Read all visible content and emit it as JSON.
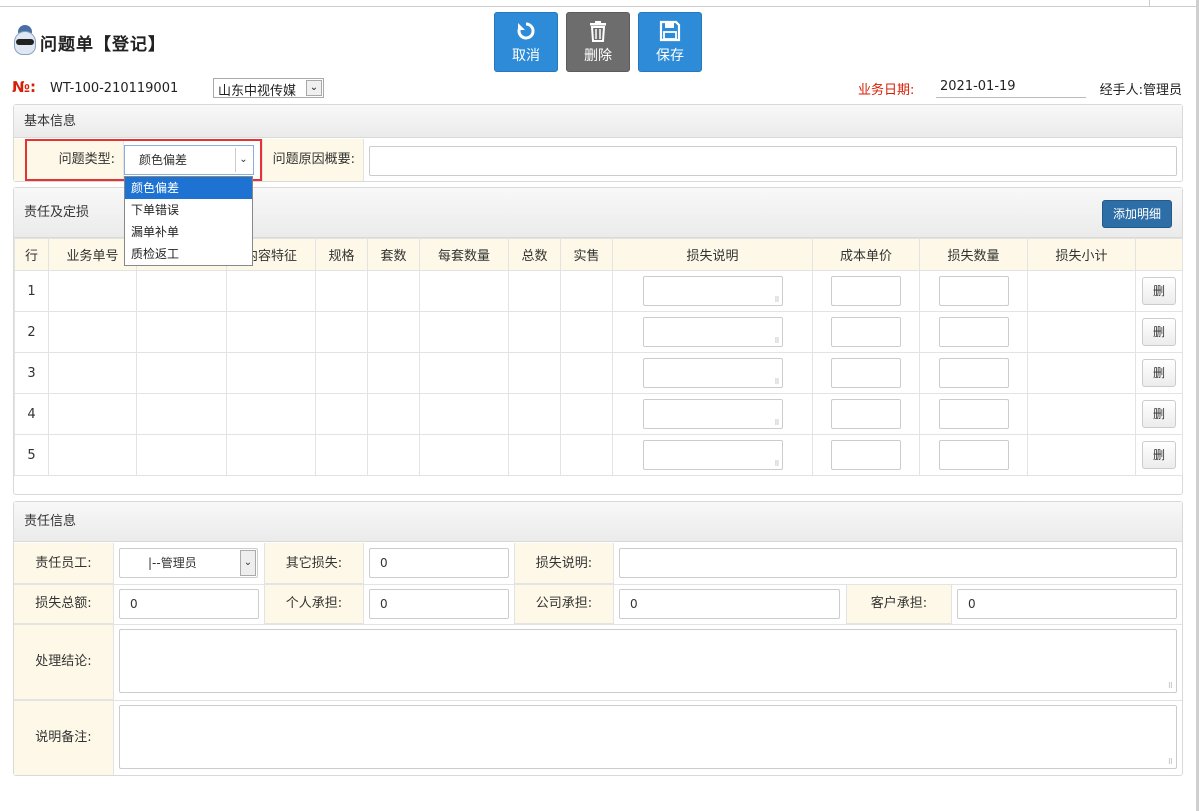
{
  "header": {
    "title": "问题单【登记】",
    "toolbar": {
      "cancel": "取消",
      "delete": "删除",
      "save": "保存"
    }
  },
  "meta": {
    "no_label": "№:",
    "no_value": "WT-100-210119001",
    "company": "山东中视传媒",
    "date_label": "业务日期:",
    "date_value": "2021-01-19",
    "handler_label": "经手人:",
    "handler_value": "管理员"
  },
  "basic": {
    "title": "基本信息",
    "type_label": "问题类型:",
    "type_value": "颜色偏差",
    "type_options": [
      "颜色偏差",
      "下单错误",
      "漏单补单",
      "质检返工"
    ],
    "reason_label": "问题原因概要:"
  },
  "liability": {
    "title": "责任及定损",
    "add_button": "添加明细",
    "columns": [
      "行",
      "业务单号",
      "",
      "内容特征",
      "规格",
      "套数",
      "每套数量",
      "总数",
      "实售",
      "损失说明",
      "成本单价",
      "损失数量",
      "损失小计",
      ""
    ],
    "rows": [
      "1",
      "2",
      "3",
      "4",
      "5"
    ],
    "delete_label": "删"
  },
  "responsibility": {
    "title": "责任信息",
    "employee_label": "责任员工:",
    "employee_value": "|--管理员",
    "other_loss_label": "其它损失:",
    "other_loss_value": "0",
    "loss_desc_label": "损失说明:",
    "total_loss_label": "损失总额:",
    "total_loss_value": "0",
    "personal_label": "个人承担:",
    "personal_value": "0",
    "company_label": "公司承担:",
    "company_value": "0",
    "customer_label": "客户承担:",
    "customer_value": "0",
    "conclusion_label": "处理结论:",
    "remark_label": "说明备注:"
  },
  "colors": {
    "accent_blue": "#2e8bd8",
    "add_blue": "#2e6ea6",
    "label_bg": "#fdf8e7",
    "alert_red": "#d81e06",
    "highlight_red": "#e53333"
  }
}
